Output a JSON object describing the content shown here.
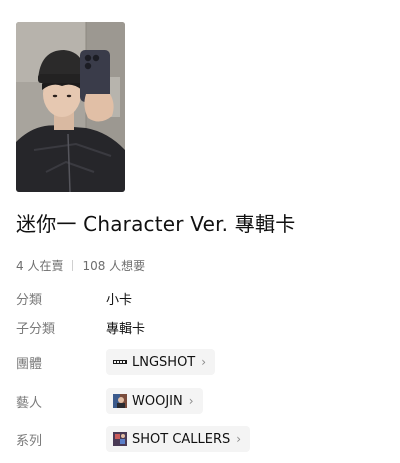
{
  "item": {
    "title": "迷你一 Character Ver. 專輯卡",
    "stats": {
      "owned": "4 人在賣",
      "wanted": "108 人想要"
    }
  },
  "attributes": {
    "category": {
      "label": "分類",
      "value": "小卡"
    },
    "subcategory": {
      "label": "子分類",
      "value": "專輯卡"
    },
    "group": {
      "label": "團體",
      "value": "LNGSHOT",
      "icon": "lngshot-logo-icon"
    },
    "artist": {
      "label": "藝人",
      "value": "WOOJIN",
      "icon": "artist-avatar-icon"
    },
    "series": {
      "label": "系列",
      "value": "SHOT CALLERS",
      "icon": "album-cover-icon"
    }
  },
  "colors": {
    "label": "#7a7a7a",
    "value": "#111111",
    "chip_bg": "#f4f4f4",
    "stat_text": "#6e6e6e"
  }
}
